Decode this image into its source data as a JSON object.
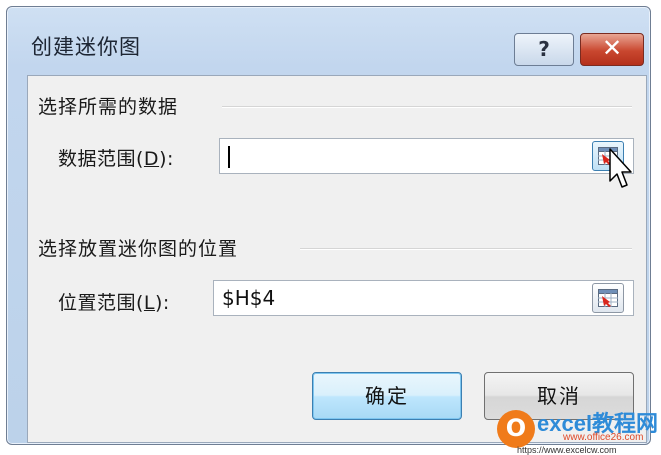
{
  "window": {
    "title": "创建迷你图",
    "help_label": "?",
    "close_label": "✕"
  },
  "data_group": {
    "header": "选择所需的数据",
    "field_label_prefix": "数据范围(",
    "field_label_key": "D",
    "field_label_suffix": "):",
    "value": ""
  },
  "location_group": {
    "header": "选择放置迷你图的位置",
    "field_label_prefix": "位置范围(",
    "field_label_key": "L",
    "field_label_suffix": "):",
    "value": "$H$4"
  },
  "buttons": {
    "ok": "确定",
    "cancel": "取消"
  },
  "icons": {
    "range_picker": "range-picker-icon",
    "cursor": "mouse-pointer-icon"
  },
  "colors": {
    "title_bar": "#c2d6ee",
    "client_bg": "#f0f0f0",
    "close_button": "#c9472f",
    "default_button_border": "#3c7fb1"
  },
  "watermark": {
    "logo_letter": "O",
    "title": "excel教程网",
    "url1": "www.office26.com",
    "url2": "https://www.excelcw.com"
  }
}
